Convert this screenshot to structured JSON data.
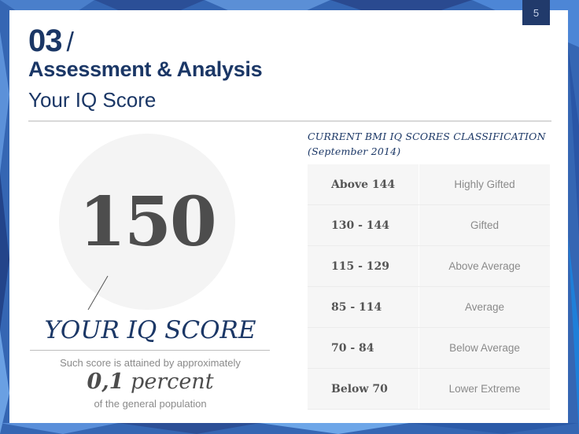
{
  "page_number": "5",
  "header": {
    "section_number": "03",
    "section_slash": "/",
    "section_title": "Assessment & Analysis",
    "subtitle": "Your IQ Score"
  },
  "score_panel": {
    "score": "150",
    "label": "YOUR IQ SCORE",
    "description_pre": "Such score is attained by approximately",
    "percent_value": "0,1",
    "percent_word": "percent",
    "description_post": "of the general population"
  },
  "classification": {
    "title_line1": "CURRENT BMI IQ SCORES CLASSIFICATION",
    "title_line2": "(September 2014)",
    "rows": [
      {
        "range": "Above 144",
        "class": "Highly Gifted"
      },
      {
        "range": "130 - 144",
        "class": "Gifted"
      },
      {
        "range": "115 - 129",
        "class": "Above Average"
      },
      {
        "range": "85 - 114",
        "class": "Average"
      },
      {
        "range": "70 - 84",
        "class": "Below Average"
      },
      {
        "range": "Below 70",
        "class": "Lower Extreme"
      }
    ]
  },
  "colors": {
    "primary_navy": "#1b3766",
    "badge": "#213a6b",
    "background_blue": "#2f62b0"
  }
}
